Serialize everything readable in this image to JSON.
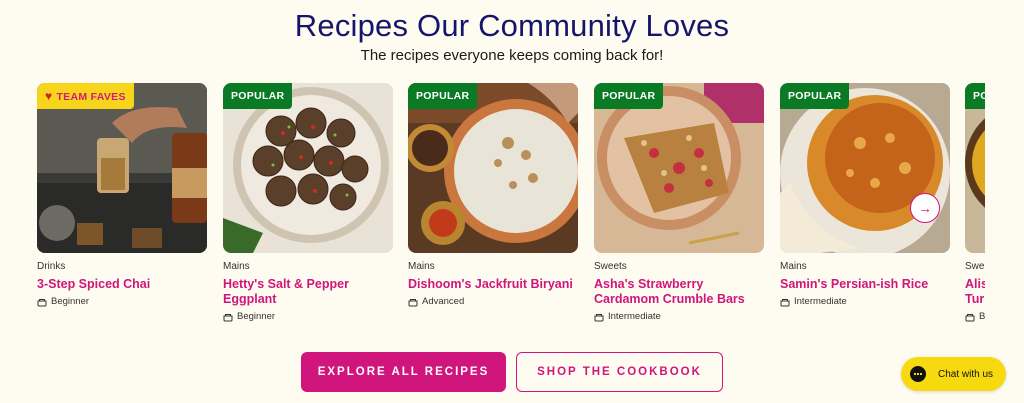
{
  "header": {
    "title": "Recipes Our Community Loves",
    "subtitle": "The recipes everyone keeps coming back for!"
  },
  "recipes": [
    {
      "badge": "TEAM FAVES",
      "category": "Drinks",
      "title": "3-Step Spiced Chai",
      "level": "Beginner"
    },
    {
      "badge": "POPULAR",
      "category": "Mains",
      "title": "Hetty's Salt & Pepper Eggplant",
      "level": "Beginner"
    },
    {
      "badge": "POPULAR",
      "category": "Mains",
      "title": "Dishoom's Jackfruit Biryani",
      "level": "Advanced"
    },
    {
      "badge": "POPULAR",
      "category": "Sweets",
      "title": "Asha's Strawberry Cardamom Crumble Bars",
      "level": "Intermediate"
    },
    {
      "badge": "POPULAR",
      "category": "Mains",
      "title": "Samin's Persian-ish Rice",
      "level": "Intermediate"
    },
    {
      "badge": "PO",
      "category": "Swe",
      "title": "Alis Tur",
      "level": "B"
    }
  ],
  "buttons": {
    "explore": "EXPLORE ALL RECIPES",
    "shop": "SHOP THE COOKBOOK"
  },
  "chat": {
    "label": "Chat with us"
  },
  "colors": {
    "accent": "#d0157c",
    "popular_badge": "#0b7a25",
    "fave_badge": "#f7d51a",
    "title": "#15166b"
  }
}
